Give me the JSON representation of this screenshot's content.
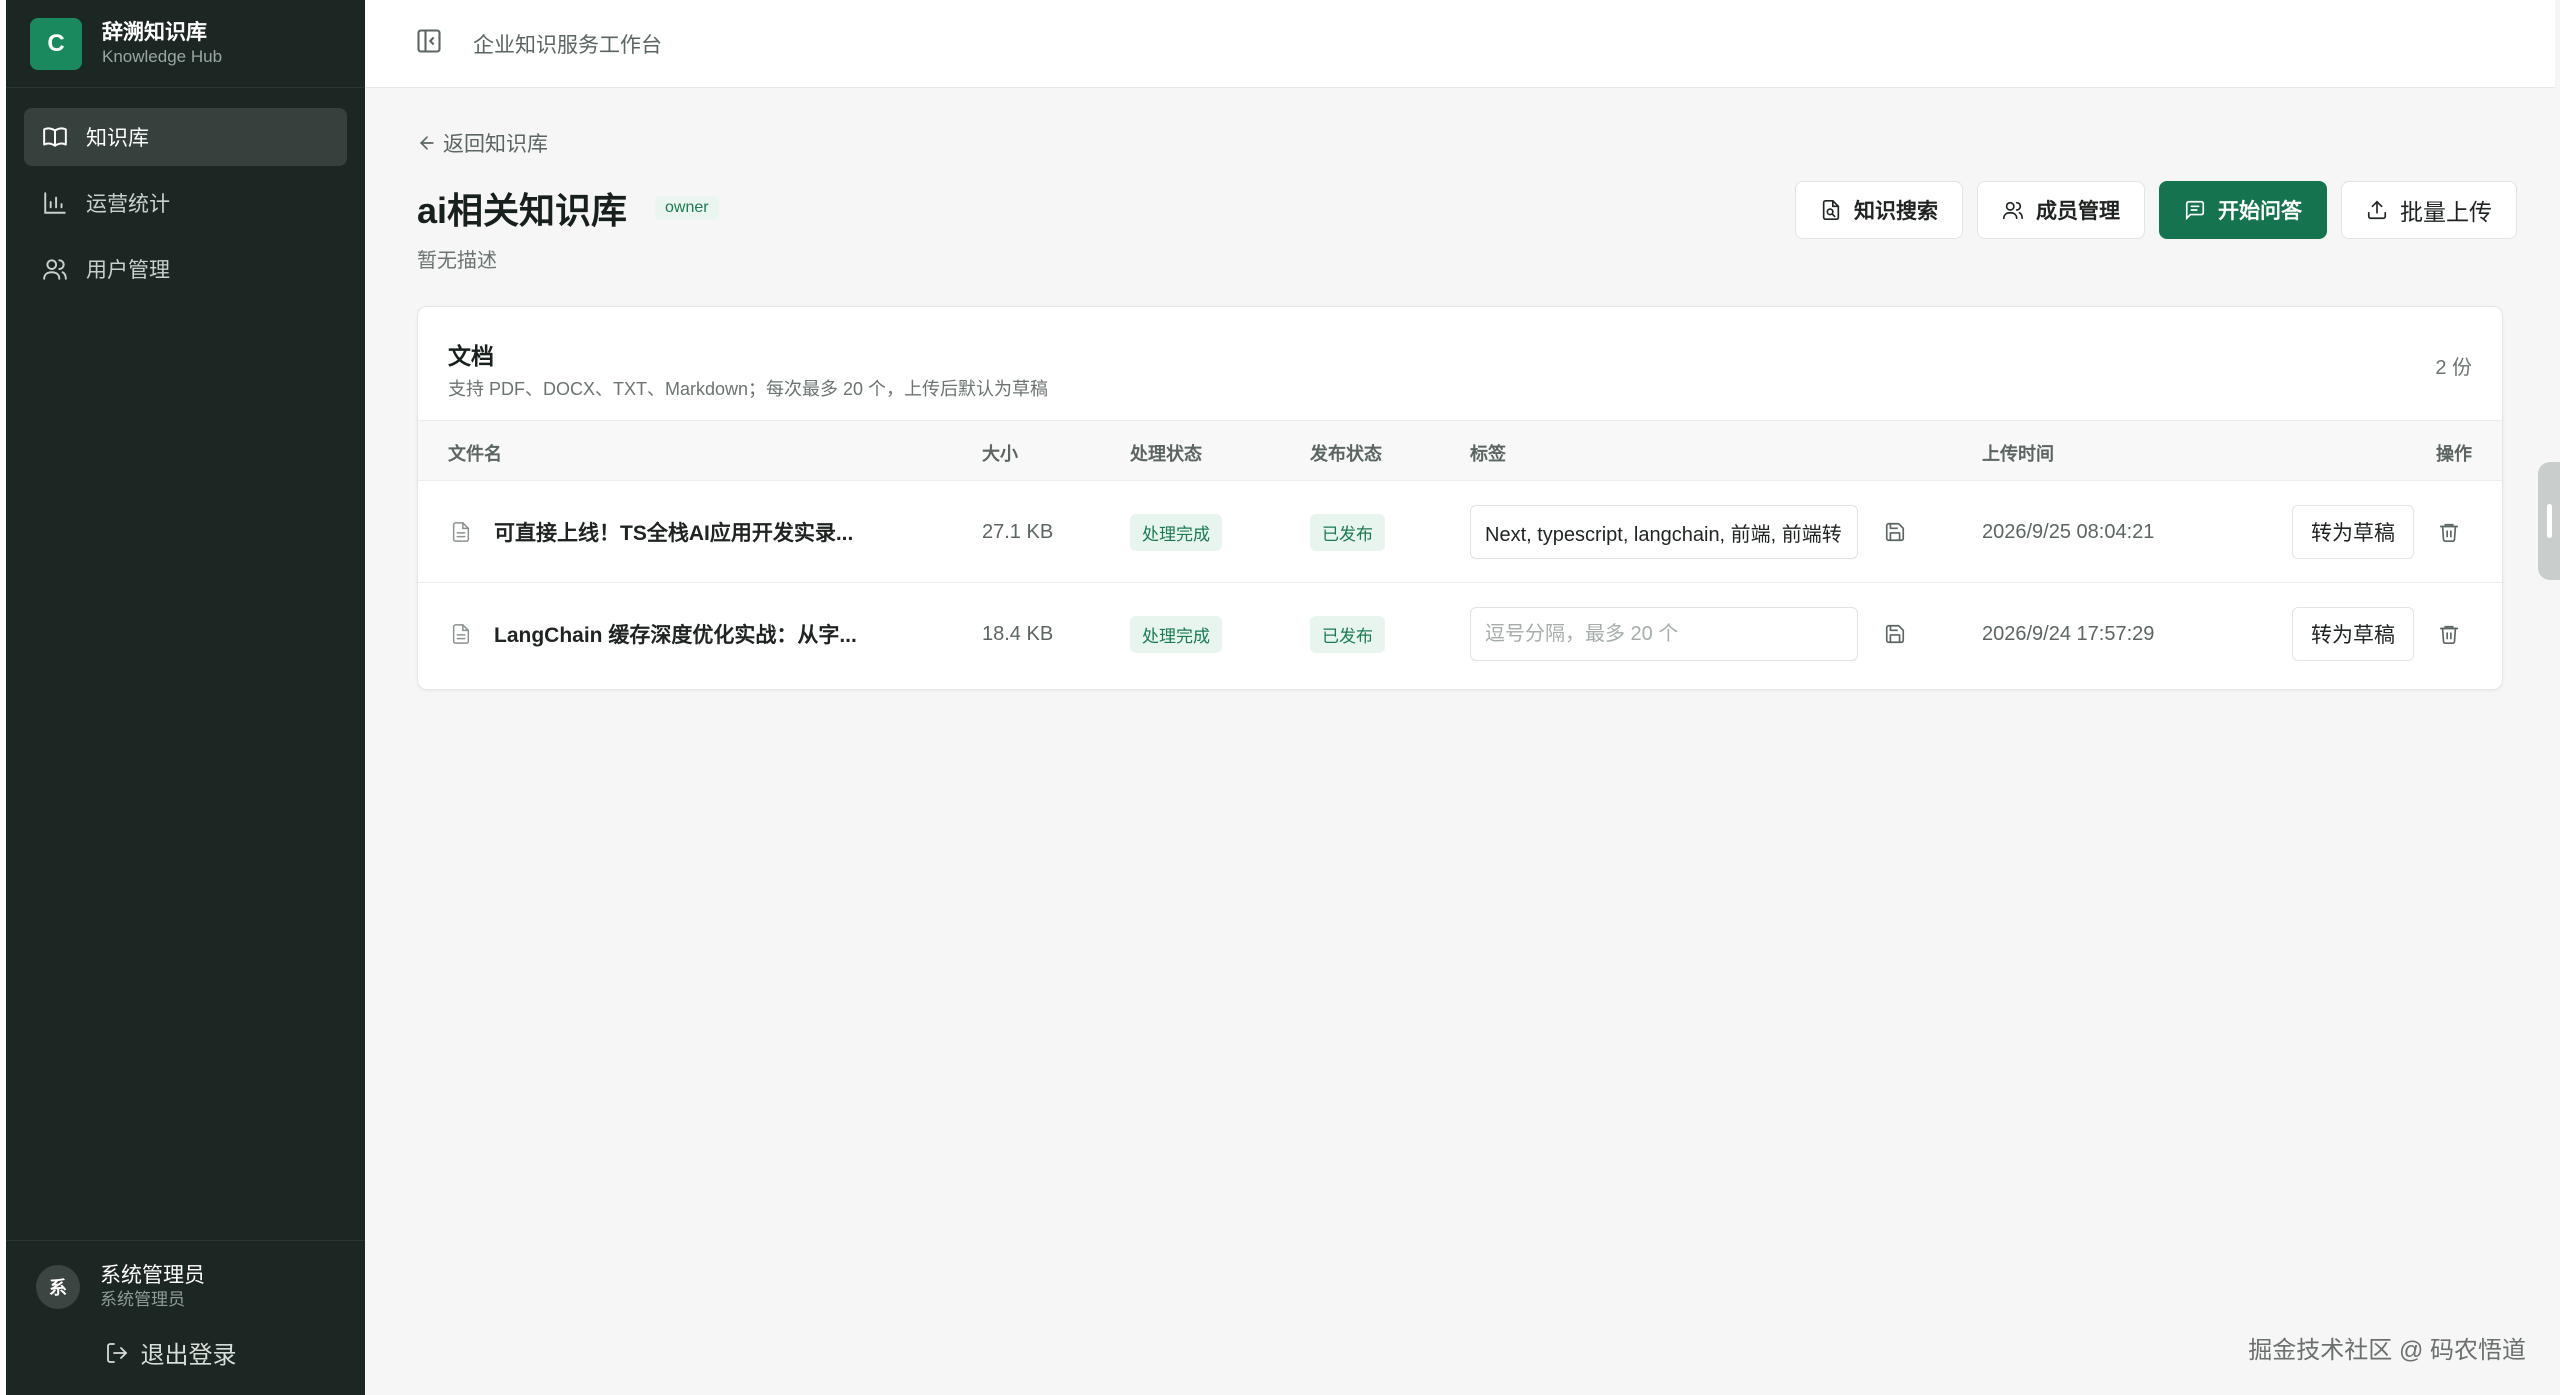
{
  "brand": {
    "logo_letter": "C",
    "name": "辞溯知识库",
    "subtitle": "Knowledge Hub"
  },
  "nav": [
    {
      "label": "知识库",
      "icon": "book-icon",
      "active": true
    },
    {
      "label": "运营统计",
      "icon": "bar-chart-icon",
      "active": false
    },
    {
      "label": "用户管理",
      "icon": "users-icon",
      "active": false
    }
  ],
  "user": {
    "avatar_letter": "系",
    "name": "系统管理员",
    "role": "系统管理员",
    "logout_label": "退出登录"
  },
  "topbar": {
    "title": "企业知识服务工作台"
  },
  "page": {
    "back_label": "返回知识库",
    "title": "ai相关知识库",
    "badge": "owner",
    "description": "暂无描述"
  },
  "actions": {
    "search": "知识搜索",
    "members": "成员管理",
    "qa": "开始问答",
    "upload": "批量上传"
  },
  "documents": {
    "title": "文档",
    "subtitle": "支持 PDF、DOCX、TXT、Markdown；每次最多 20 个，上传后默认为草稿",
    "count": "2 份",
    "columns": {
      "name": "文件名",
      "size": "大小",
      "process": "处理状态",
      "publish": "发布状态",
      "tags": "标签",
      "uploaded": "上传时间",
      "ops": "操作"
    },
    "tag_placeholder": "逗号分隔，最多 20 个",
    "rows": [
      {
        "name": "可直接上线！TS全栈AI应用开发实录...",
        "size": "27.1 KB",
        "process_status": "处理完成",
        "publish_status": "已发布",
        "tags": "Next, typescript, langchain, 前端, 前端转",
        "uploaded": "2026/9/25 08:04:21",
        "draft_label": "转为草稿"
      },
      {
        "name": "LangChain 缓存深度优化实战：从字...",
        "size": "18.4 KB",
        "process_status": "处理完成",
        "publish_status": "已发布",
        "tags": "",
        "uploaded": "2026/9/24 17:57:29",
        "draft_label": "转为草稿"
      }
    ]
  },
  "watermark": "掘金技术社区 @ 码农悟道",
  "colors": {
    "sidebar": "#1c2622",
    "accent": "#15744f",
    "badge_bg": "#e8f5ee",
    "badge_text": "#1a7a52"
  }
}
